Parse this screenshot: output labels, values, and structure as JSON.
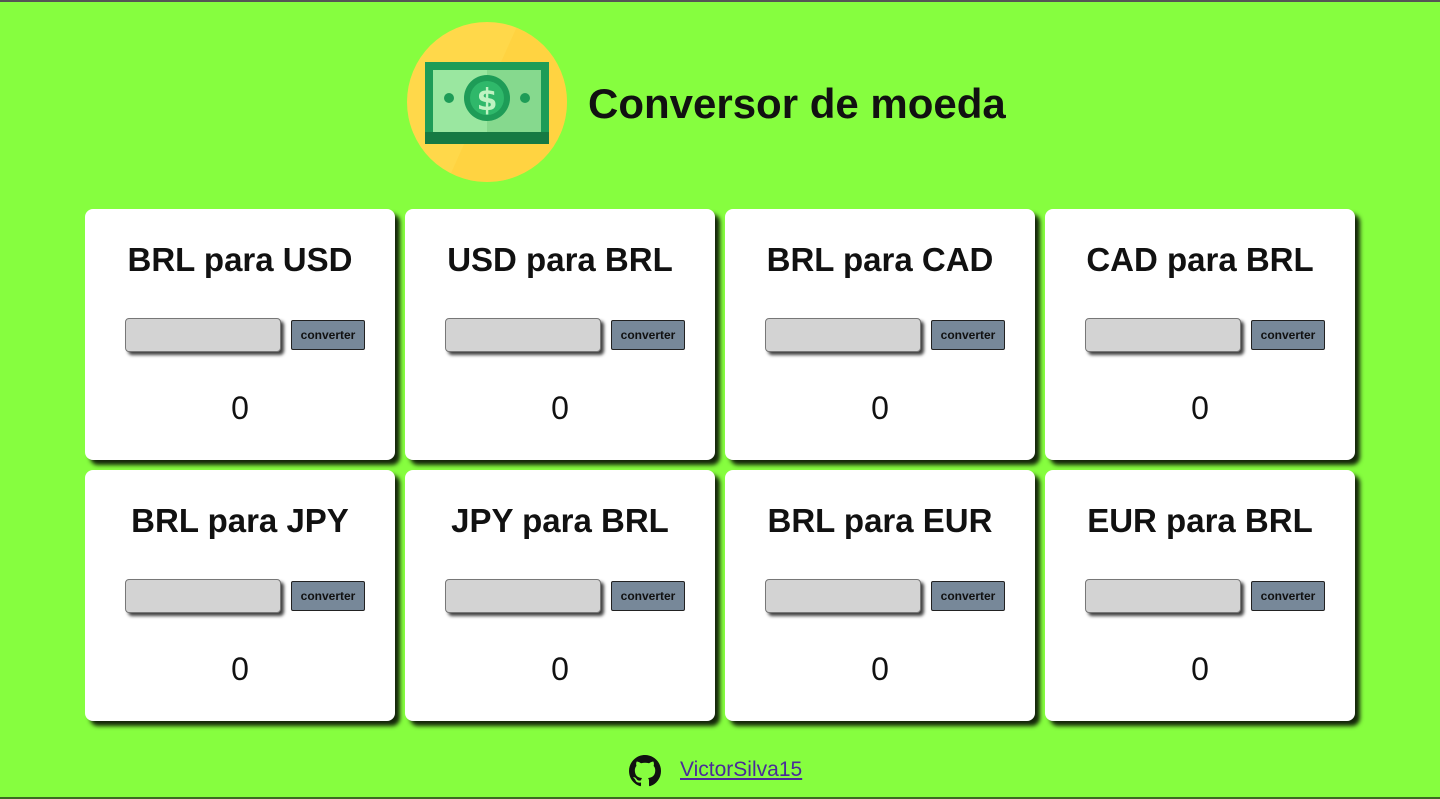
{
  "header": {
    "title": "Conversor de moeda",
    "logo_icon": "money-bill-icon"
  },
  "converters": [
    {
      "title": "BRL para USD",
      "input_value": "",
      "button_label": "converter",
      "result": "0"
    },
    {
      "title": "USD para BRL",
      "input_value": "",
      "button_label": "converter",
      "result": "0"
    },
    {
      "title": "BRL para CAD",
      "input_value": "",
      "button_label": "converter",
      "result": "0"
    },
    {
      "title": "CAD para BRL",
      "input_value": "",
      "button_label": "converter",
      "result": "0"
    },
    {
      "title": "BRL para JPY",
      "input_value": "",
      "button_label": "converter",
      "result": "0"
    },
    {
      "title": "JPY para BRL",
      "input_value": "",
      "button_label": "converter",
      "result": "0"
    },
    {
      "title": "BRL para EUR",
      "input_value": "",
      "button_label": "converter",
      "result": "0"
    },
    {
      "title": "EUR para BRL",
      "input_value": "",
      "button_label": "converter",
      "result": "0"
    }
  ],
  "footer": {
    "icon": "github-icon",
    "link_text": "VictorSilva15"
  },
  "colors": {
    "background": "#86fe3f",
    "card": "#ffffff",
    "input": "#d3d3d3",
    "button": "#778899",
    "logo_circle": "#ffd84a",
    "link": "#4a2a9a"
  }
}
